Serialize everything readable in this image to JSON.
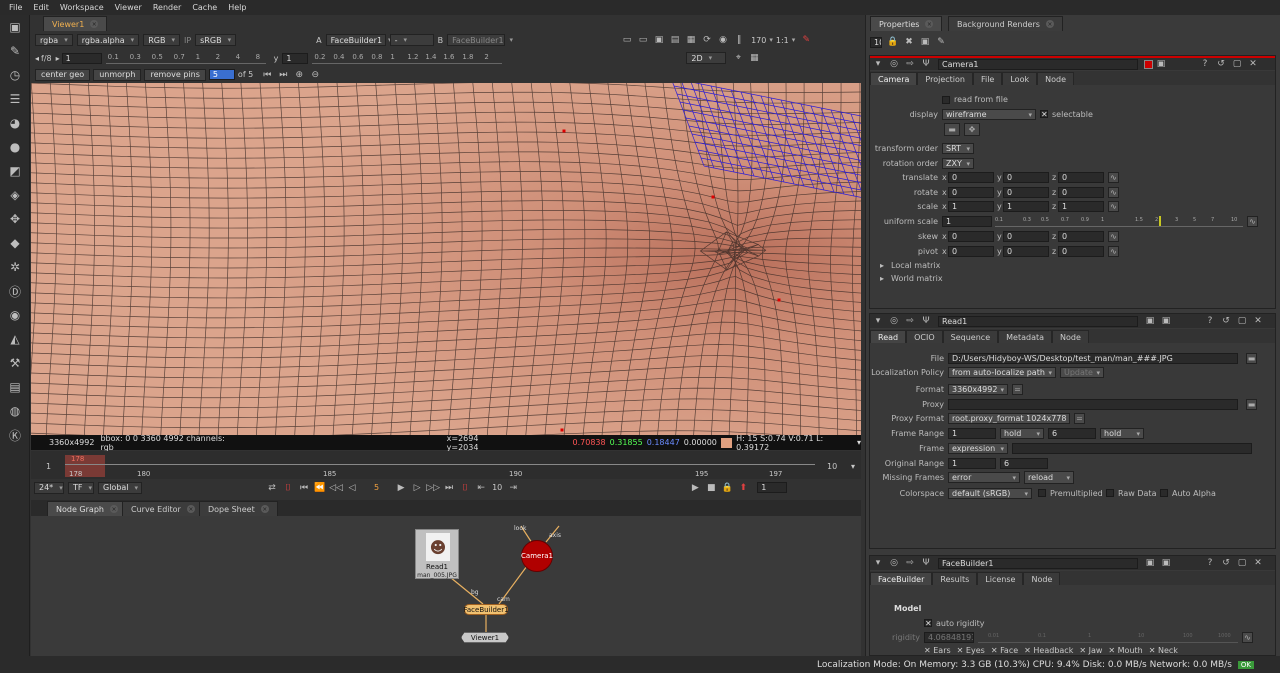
{
  "menu": [
    "File",
    "Edit",
    "Workspace",
    "Viewer",
    "Render",
    "Cache",
    "Help"
  ],
  "viewer": {
    "tab": "Viewer1",
    "channels": "rgba",
    "alpha": "rgba.alpha",
    "colorspace_channels": "RGB",
    "ip": "IP",
    "lut": "sRGB",
    "input_a_label": "A",
    "input_a": "FaceBuilder1",
    "input_a_blend": "-",
    "input_b_label": "B",
    "input_b": "FaceBuilder1",
    "zoom": "170",
    "ratio": "1:1",
    "fstop": "f/8",
    "gain": "1",
    "gamma_label": "y",
    "gamma": "1",
    "gain_ticks": [
      "0.1",
      "0.3",
      "0.5",
      "0.7",
      "1",
      "2",
      "4",
      "8"
    ],
    "gamma_ticks": [
      "0.2",
      "0.4",
      "0.6",
      "0.8",
      "1",
      "1.2",
      "1.4",
      "1.6",
      "1.8",
      "2"
    ],
    "mode": "2D",
    "buttons": {
      "center_geo": "center geo",
      "unmorph": "unmorph",
      "remove_pins": "remove pins"
    },
    "frame_current": "5",
    "frame_of": "of 5",
    "status_format": "3360x4992",
    "status_bbox": "bbox: 0 0 3360 4992 channels: rgb",
    "status_xy": "x=2694 y=2034",
    "status_r": "0.70838",
    "status_g": "0.31855",
    "status_b": "0.18447",
    "status_a": "0.00000",
    "status_hsvl": "H: 15 S:0.74 V:0.71  L: 0.39172",
    "colors": {
      "skin": "#d59a82",
      "r": "#ff5555",
      "g": "#55ff55",
      "b": "#5588ff",
      "swatch": "#e0a080"
    }
  },
  "timeline": {
    "start": "1",
    "end": "10",
    "in": "178",
    "labels": [
      "178",
      "180",
      "185",
      "190",
      "195",
      "197"
    ],
    "fps": "24*",
    "tf": "TF",
    "global": "Global",
    "frame": "5",
    "step": "10",
    "play_end": "1"
  },
  "tabs_bottom": [
    "Node Graph",
    "Curve Editor",
    "Dope Sheet"
  ],
  "nodes": {
    "read": "Read1",
    "read_file": "man_005.JPG",
    "camera": "Camera1",
    "facebuilder": "FaceBuilder1",
    "viewer": "Viewer1",
    "in_bg": "bg",
    "in_cam": "cam",
    "in_look": "look",
    "in_axis": "axis"
  },
  "properties": {
    "tab_props": "Properties",
    "tab_bg": "Background Renders",
    "max_panels": "10",
    "camera": {
      "name": "Camera1",
      "tabs": [
        "Camera",
        "Projection",
        "File",
        "Look",
        "Node"
      ],
      "read_from_file": "read from file",
      "display_label": "display",
      "display": "wireframe",
      "selectable": "selectable",
      "transform_order_label": "transform order",
      "transform_order": "SRT",
      "rotation_order_label": "rotation order",
      "rotation_order": "ZXY",
      "translate_label": "translate",
      "rotate_label": "rotate",
      "scale_label": "scale",
      "uniform_scale_label": "uniform scale",
      "skew_label": "skew",
      "pivot_label": "pivot",
      "translate": [
        "0",
        "0",
        "0"
      ],
      "rotate": [
        "0",
        "0",
        "0"
      ],
      "scale": [
        "1",
        "1",
        "1"
      ],
      "uniform_scale": "1",
      "skew": [
        "0",
        "0",
        "0"
      ],
      "pivot": [
        "0",
        "0",
        "0"
      ],
      "axis_x": "x",
      "axis_y": "y",
      "axis_z": "z",
      "scale_ticks": [
        "0.1",
        "0.2",
        "0.3",
        "0.4",
        "0.5",
        "0.6",
        "0.7",
        "0.8",
        "0.9",
        "1",
        "1.5",
        "2",
        "3",
        "4",
        "5",
        "6",
        "7",
        "8",
        "9",
        "10"
      ],
      "local_matrix": "Local matrix",
      "world_matrix": "World matrix"
    },
    "read": {
      "name": "Read1",
      "tabs": [
        "Read",
        "OCIO",
        "Sequence",
        "Metadata",
        "Node"
      ],
      "file_label": "File",
      "file": "D:/Users/Hidyboy-WS/Desktop/test_man/man_###.JPG",
      "localization_label": "Localization Policy",
      "localization": "from auto-localize path",
      "update": "Update",
      "format_label": "Format",
      "format": "3360x4992",
      "proxy_label": "Proxy",
      "proxy_format_label": "Proxy Format",
      "proxy_format": "root.proxy_format 1024x778",
      "frame_range_label": "Frame Range",
      "fr_start": "1",
      "fr_start_mode": "hold",
      "fr_end": "6",
      "fr_end_mode": "hold",
      "frame_label": "Frame",
      "frame_mode": "expression",
      "orig_range_label": "Original Range",
      "or_start": "1",
      "or_end": "6",
      "missing_label": "Missing Frames",
      "missing": "error",
      "reload": "reload",
      "colorspace_label": "Colorspace",
      "colorspace": "default (sRGB)",
      "premult": "Premultiplied",
      "raw": "Raw Data",
      "auto_alpha": "Auto Alpha"
    },
    "facebuilder": {
      "name": "FaceBuilder1",
      "tabs": [
        "FaceBuilder",
        "Results",
        "License",
        "Node"
      ],
      "model": "Model",
      "auto_rigidity": "auto rigidity",
      "rigidity_label": "rigidity",
      "rigidity": "4.06848193",
      "rigidity_ticks": [
        "0.01",
        "0.1",
        "1",
        "10",
        "100",
        "1000"
      ],
      "parts": [
        "Ears",
        "Eyes",
        "Face",
        "Headback",
        "Jaw",
        "Mouth",
        "Neck"
      ]
    }
  },
  "bottom_status": "Localization Mode: On Memory: 3.3 GB (10.3%) CPU: 9.4% Disk: 0.0 MB/s Network: 0.0 MB/s",
  "bottom_badge": "OK"
}
